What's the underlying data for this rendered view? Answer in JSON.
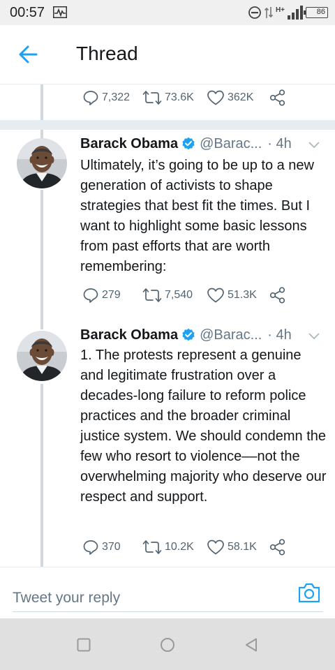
{
  "status_bar": {
    "time": "00:57",
    "network_label": "H+",
    "battery": "86"
  },
  "header": {
    "title": "Thread"
  },
  "previous_tweet": {
    "replies": "7,322",
    "retweets": "73.6K",
    "likes": "362K"
  },
  "tweets": [
    {
      "name": "Barack Obama",
      "handle": "@Barac...",
      "time": "· 4h",
      "text": "Ultimately, it’s going to be up to a new generation of activists to shape strategies that best fit the times. But I want to highlight some basic lessons from past efforts that are worth remembering:",
      "replies": "279",
      "retweets": "7,540",
      "likes": "51.3K"
    },
    {
      "name": "Barack Obama",
      "handle": "@Barac...",
      "time": "· 4h",
      "text": "1. The protests represent a genuine and legitimate frustration over a decades-long failure to reform police practices and the broader criminal justice system. We should condemn the few who resort to violence––not the overwhelming majority who deserve our respect and support.",
      "replies": "370",
      "retweets": "10.2K",
      "likes": "58.1K"
    }
  ],
  "reply_bar": {
    "placeholder": "Tweet your reply"
  },
  "colors": {
    "accent": "#1da1f2",
    "secondary_text": "#657786",
    "divider": "#e6ecf0"
  }
}
